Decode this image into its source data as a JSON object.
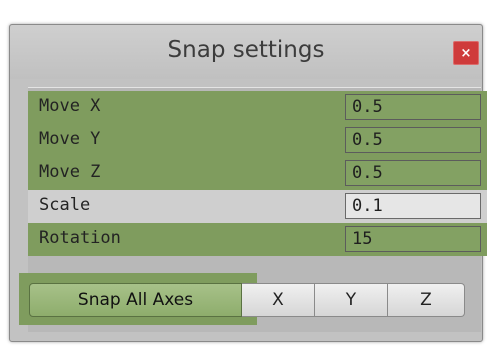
{
  "window": {
    "title": "Snap settings",
    "close_label": "×"
  },
  "rows": [
    {
      "label": "Move X",
      "value": "0.5",
      "highlighted": true
    },
    {
      "label": "Move Y",
      "value": "0.5",
      "highlighted": true
    },
    {
      "label": "Move Z",
      "value": "0.5",
      "highlighted": true
    },
    {
      "label": "Scale",
      "value": "0.1",
      "highlighted": false
    },
    {
      "label": "Rotation",
      "value": "15",
      "highlighted": true
    }
  ],
  "buttons": {
    "snap_all": "Snap All Axes",
    "x": "X",
    "y": "Y",
    "z": "Z"
  },
  "colors": {
    "highlight": "#7f9c5e",
    "close": "#cf3b3b",
    "panel": "#c2c2c2"
  }
}
